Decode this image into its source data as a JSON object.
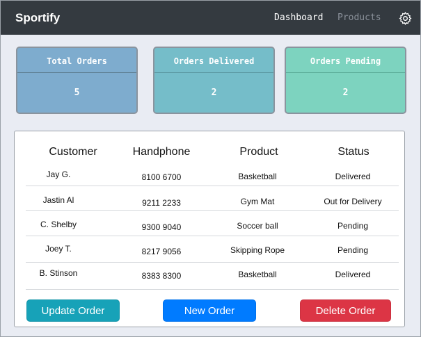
{
  "app": {
    "brand": "Sportify"
  },
  "nav": {
    "dashboard": "Dashboard",
    "products": "Products",
    "settings_icon": "gear-icon"
  },
  "cards": [
    {
      "title": "Total Orders",
      "value": "5"
    },
    {
      "title": "Orders Delivered",
      "value": "2"
    },
    {
      "title": "Orders Pending",
      "value": "2"
    }
  ],
  "table": {
    "headers": [
      "Customer",
      "Handphone",
      "Product",
      "Status"
    ],
    "rows": [
      {
        "customer": "Jay G.",
        "phone": "8100 6700",
        "product": "Basketball",
        "status": "Delivered"
      },
      {
        "customer": "Jastin Al",
        "phone": "9211 2233",
        "product": "Gym Mat",
        "status": "Out for Delivery"
      },
      {
        "customer": "C. Shelby",
        "phone": "9300 9040",
        "product": "Soccer ball",
        "status": "Pending"
      },
      {
        "customer": "Joey T.",
        "phone": "8217 9056",
        "product": "Skipping Rope",
        "status": "Pending"
      },
      {
        "customer": "B. Stinson",
        "phone": "8383 8300",
        "product": "Basketball",
        "status": "Delivered"
      }
    ]
  },
  "buttons": {
    "update": "Update Order",
    "new": "New Order",
    "delete": "Delete Order"
  },
  "colors": {
    "navbar": "#343a40",
    "card_total": "#7eacce",
    "card_delivered": "#75bdc9",
    "card_pending": "#7dd3bf",
    "update": "#17a2b8",
    "new": "#007bff",
    "delete": "#dc3545"
  }
}
